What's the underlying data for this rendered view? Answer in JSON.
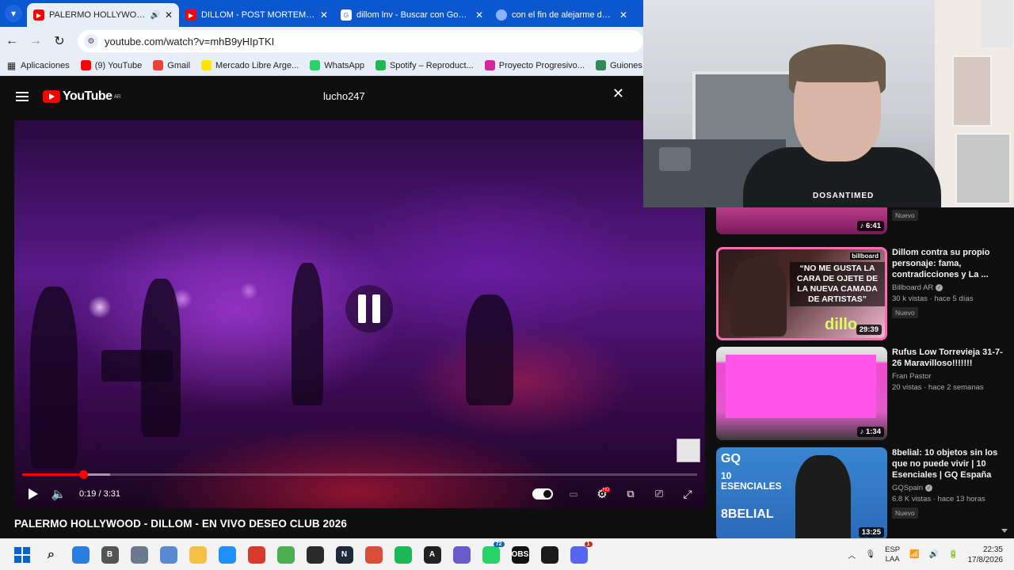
{
  "browser": {
    "tabs": [
      {
        "title": "PALERMO HOLLYWOOD - D",
        "favicon": "youtube-icon",
        "active": true,
        "audio": true
      },
      {
        "title": "DILLOM - POST MORTEM TOUR",
        "favicon": "youtube-icon",
        "active": false
      },
      {
        "title": "dillom lnv - Buscar con Google",
        "favicon": "google-icon",
        "active": false
      },
      {
        "title": "con el fin de alejarme de vos...",
        "favicon": "generic-icon",
        "active": false
      }
    ],
    "url": "youtube.com/watch?v=mhB9yHIpTKI",
    "bookmarks": [
      {
        "label": "Aplicaciones",
        "icon": "apps-grid-icon",
        "color": "#1f1f1f"
      },
      {
        "label": "(9) YouTube",
        "icon": "youtube-icon",
        "color": "#ff0000"
      },
      {
        "label": "Gmail",
        "icon": "gmail-icon",
        "color": "#ea4335"
      },
      {
        "label": "Mercado Libre Arge...",
        "icon": "mercadolibre-icon",
        "color": "#ffe600"
      },
      {
        "label": "WhatsApp",
        "icon": "whatsapp-icon",
        "color": "#25d366"
      },
      {
        "label": "Spotify – Reproduct...",
        "icon": "spotify-icon",
        "color": "#1db954"
      },
      {
        "label": "Proyecto Progresivo...",
        "icon": "instagram-icon",
        "color": "#d6249f"
      },
      {
        "label": "Guiones a fi",
        "icon": "leaf-icon",
        "color": "#2e8b57"
      }
    ]
  },
  "youtube": {
    "logo_text": "YouTube",
    "region": "AR",
    "search_query": "lucho247"
  },
  "player": {
    "current_time": "0:19",
    "duration": "3:31",
    "time_display": "0:19 / 3:31",
    "played_fraction": 0.09,
    "buffered_fraction": 0.13,
    "state": "paused-indicator",
    "hd_badge": "HD"
  },
  "video": {
    "title": "PALERMO HOLLYWOOD - DILLOM - EN VIVO DESEO CLUB 2026"
  },
  "webcam": {
    "shirt_text": "DOSANTIMED"
  },
  "recommendations": [
    {
      "title": "",
      "channel": "",
      "stats": "",
      "badge": "Nuevo",
      "duration": "6:41",
      "music": true
    },
    {
      "title": "Dillom contra su propio personaje: fama, contradicciones y La ...",
      "channel": "Billboard AR",
      "verified": true,
      "stats": "30 k vistas · hace 5 días",
      "badge": "Nuevo",
      "duration": "29:39",
      "thumb_quote": "“NO ME GUSTA LA CARA DE OJETE DE LA NUEVA CAMADA DE ARTISTAS”",
      "thumb_tag": "billboard",
      "thumb_brand": "dillo"
    },
    {
      "title": "Rufus Low Torrevieja 31-7-26 Maravilloso!!!!!!!",
      "channel": "Fran Pastor",
      "verified": false,
      "stats": "20 vistas · hace 2 semanas",
      "badge": "",
      "duration": "1:34",
      "music": true
    },
    {
      "title": "8belial: 10 objetos sin los que no puede vivir | 10 Esenciales | GQ España",
      "channel": "GQSpain",
      "verified": true,
      "stats": "6.8 K vistas · hace 13 horas",
      "badge": "Nuevo",
      "duration": "13:25",
      "thumb_gq": "GQ",
      "thumb_esc": "10 ESENCIALES",
      "thumb_name": "8BELIAL"
    }
  ],
  "taskbar": {
    "apps": [
      {
        "name": "start-icon",
        "color": "#0a64c8",
        "label": ""
      },
      {
        "name": "search-icon",
        "color": "#444444",
        "label": ""
      },
      {
        "name": "copilot-icon",
        "color": "#2a7de1",
        "label": ""
      },
      {
        "name": "b-app-icon",
        "color": "#555555",
        "label": "B"
      },
      {
        "name": "settings-icon",
        "color": "#6b7a8f",
        "label": ""
      },
      {
        "name": "screenshot-tool-icon",
        "color": "#5a8bd0",
        "label": ""
      },
      {
        "name": "file-explorer-icon",
        "color": "#f4c242",
        "label": ""
      },
      {
        "name": "bolt-app-icon",
        "color": "#1e90ff",
        "label": ""
      },
      {
        "name": "red-app-icon",
        "color": "#d9382b",
        "label": ""
      },
      {
        "name": "green-app-icon",
        "color": "#4caf50",
        "label": ""
      },
      {
        "name": "obs-icon",
        "color": "#2b2b2b",
        "label": ""
      },
      {
        "name": "n-app-icon",
        "color": "#1c2a3a",
        "label": "N"
      },
      {
        "name": "chrome-icon",
        "color": "#dd4b39",
        "label": ""
      },
      {
        "name": "spotify-icon",
        "color": "#1db954",
        "label": ""
      },
      {
        "name": "capcut-icon",
        "color": "#222222",
        "label": "A"
      },
      {
        "name": "diamond-app-icon",
        "color": "#6a5acd",
        "label": ""
      },
      {
        "name": "whatsapp-icon",
        "color": "#25d366",
        "label": "",
        "badge": "72"
      },
      {
        "name": "obs-dark-icon",
        "color": "#111111",
        "label": "OBS"
      },
      {
        "name": "capcut-dark-icon",
        "color": "#1a1a1a",
        "label": ""
      },
      {
        "name": "discord-icon",
        "color": "#5865f2",
        "label": "",
        "badge": "1",
        "badge_red": true
      }
    ],
    "lang_top": "ESP",
    "lang_bottom": "LAA",
    "time": "22:35",
    "date": "17/8/2026"
  }
}
